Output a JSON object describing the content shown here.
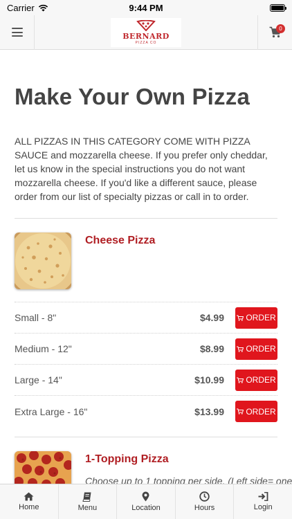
{
  "status_bar": {
    "carrier": "Carrier",
    "time": "9:44 PM"
  },
  "header": {
    "logo_text": "BERNARD",
    "logo_subtext": "PIZZA CO",
    "cart_count": "0"
  },
  "page": {
    "title": "Make Your Own Pizza",
    "description": "ALL PIZZAS IN THIS CATEGORY COME WITH PIZZA SAUCE and mozzarella cheese. If you prefer only cheddar, let us know in the special instructions you do not want mozzarella cheese. If you'd like a different sauce, please order from our list of specialty pizzas or call in to order."
  },
  "products": [
    {
      "name": "Cheese Pizza",
      "sizes": [
        {
          "label": "Small - 8\"",
          "price": "$4.99",
          "button": "ORDER"
        },
        {
          "label": "Medium - 12\"",
          "price": "$8.99",
          "button": "ORDER"
        },
        {
          "label": "Large - 14\"",
          "price": "$10.99",
          "button": "ORDER"
        },
        {
          "label": "Extra Large - 16\"",
          "price": "$13.99",
          "button": "ORDER"
        }
      ]
    },
    {
      "name": "1-Topping Pizza",
      "description": "Choose up to 1 topping per side. (Left side= one"
    }
  ],
  "tabs": [
    {
      "label": "Home",
      "icon": "home-icon"
    },
    {
      "label": "Menu",
      "icon": "menu-book-icon"
    },
    {
      "label": "Location",
      "icon": "location-pin-icon"
    },
    {
      "label": "Hours",
      "icon": "clock-icon"
    },
    {
      "label": "Login",
      "icon": "login-icon"
    }
  ],
  "colors": {
    "accent_red": "#e0161d",
    "product_name_red": "#b01e23",
    "header_bg": "#f7f7f7",
    "text_dark": "#444444"
  }
}
